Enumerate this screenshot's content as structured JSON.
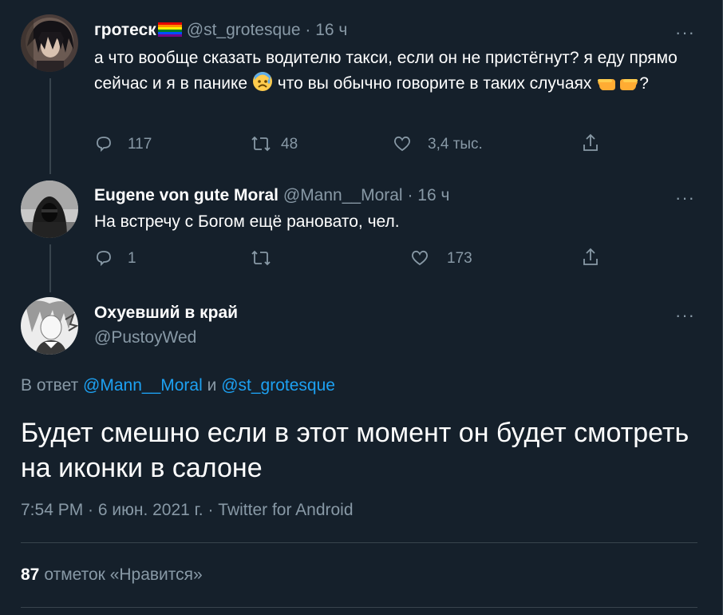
{
  "tweets": [
    {
      "name": "гротеск",
      "handle": "@st_grotesque",
      "sep": "·",
      "time": "16 ч",
      "text_part1": "а что вообще сказать водителю такси, если он не пристёгнут? я едy прямо сейчас и я в панике ",
      "text_part2": " что вы обычно говорите в таких случаях ",
      "text_part3": "?",
      "emoji1": "anxious-sweat-face",
      "emoji2": "pointing-hands",
      "replies": "117",
      "retweets": "48",
      "likes": "3,4 тыс."
    },
    {
      "name": "Eugene von gute Moral",
      "handle": "@Mann__Moral",
      "sep": "·",
      "time": "16 ч",
      "text": "На встречу с Богом ещё рановато, чел.",
      "replies": "1",
      "retweets": "",
      "likes": "173"
    }
  ],
  "main_tweet": {
    "name": "Охуевший в край",
    "handle": "@PustoyWed",
    "reply_prefix": "В ответ",
    "reply_user1": "@Mann__Moral",
    "reply_and": "и",
    "reply_user2": "@st_grotesque",
    "text": "Будет смешно если в этот момент он будет смотреть на иконки в салоне",
    "timestamp": "7:54 PM · 6 июн. 2021 г. · Twitter for Android",
    "likes_count": "87",
    "likes_label": "отметок «Нравится»"
  },
  "more_label": "···",
  "colors": {
    "background": "#15202b",
    "text": "#ffffff",
    "secondary": "#8899a6",
    "link": "#1da1f2",
    "border": "#38444d"
  }
}
